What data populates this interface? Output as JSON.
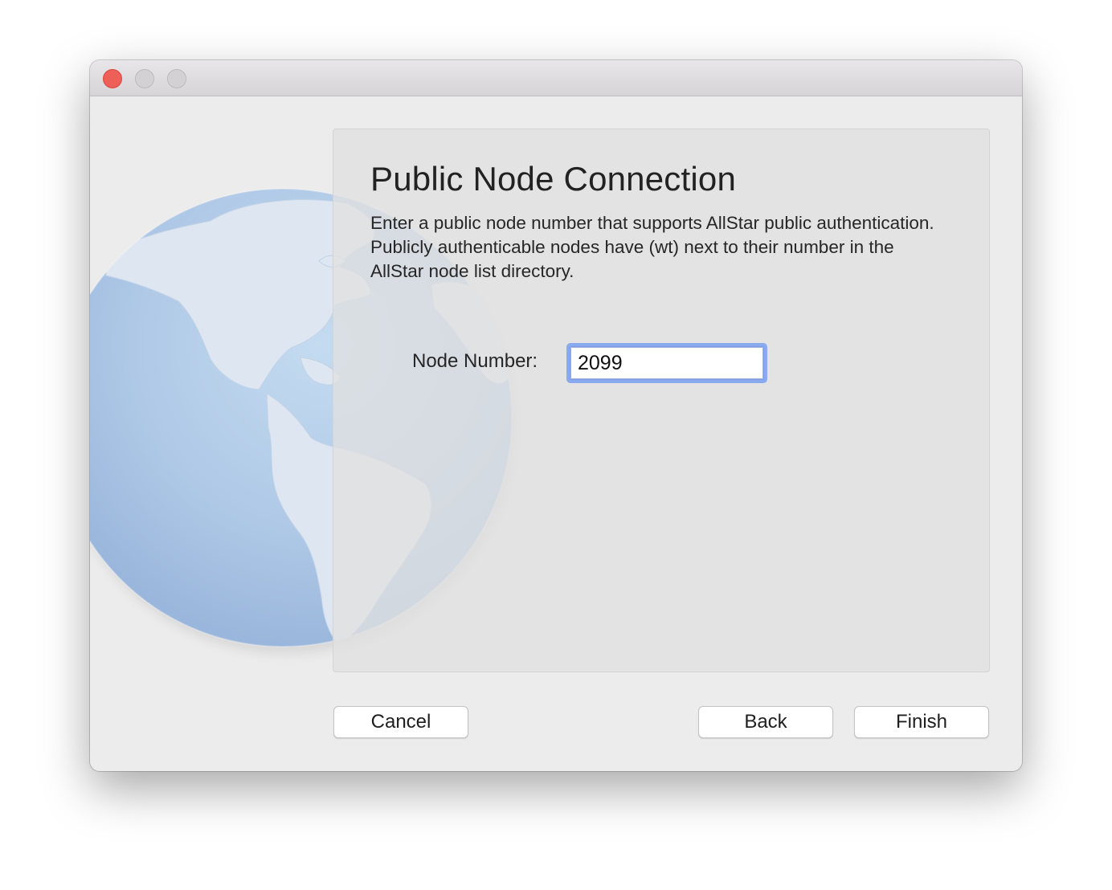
{
  "window": {
    "title": "",
    "controls": [
      "close",
      "minimize",
      "zoom"
    ]
  },
  "panel": {
    "title": "Public Node Connection",
    "description": "Enter a public node number that supports AllStar public authentication. Publicly authenticable nodes have (wt) next to their number in the AllStar node list directory.",
    "node_field": {
      "label": "Node Number:",
      "value": "2099"
    }
  },
  "buttons": {
    "cancel": "Cancel",
    "back": "Back",
    "finish": "Finish"
  },
  "colors": {
    "close": "#ee5f58",
    "focus_ring": "#8aaaf0",
    "globe_ocean": "#a9c6e6",
    "globe_land": "#dce6f1"
  },
  "icons": {
    "close": "close-icon",
    "minimize": "minimize-icon",
    "zoom": "zoom-icon",
    "globe": "globe-icon"
  }
}
